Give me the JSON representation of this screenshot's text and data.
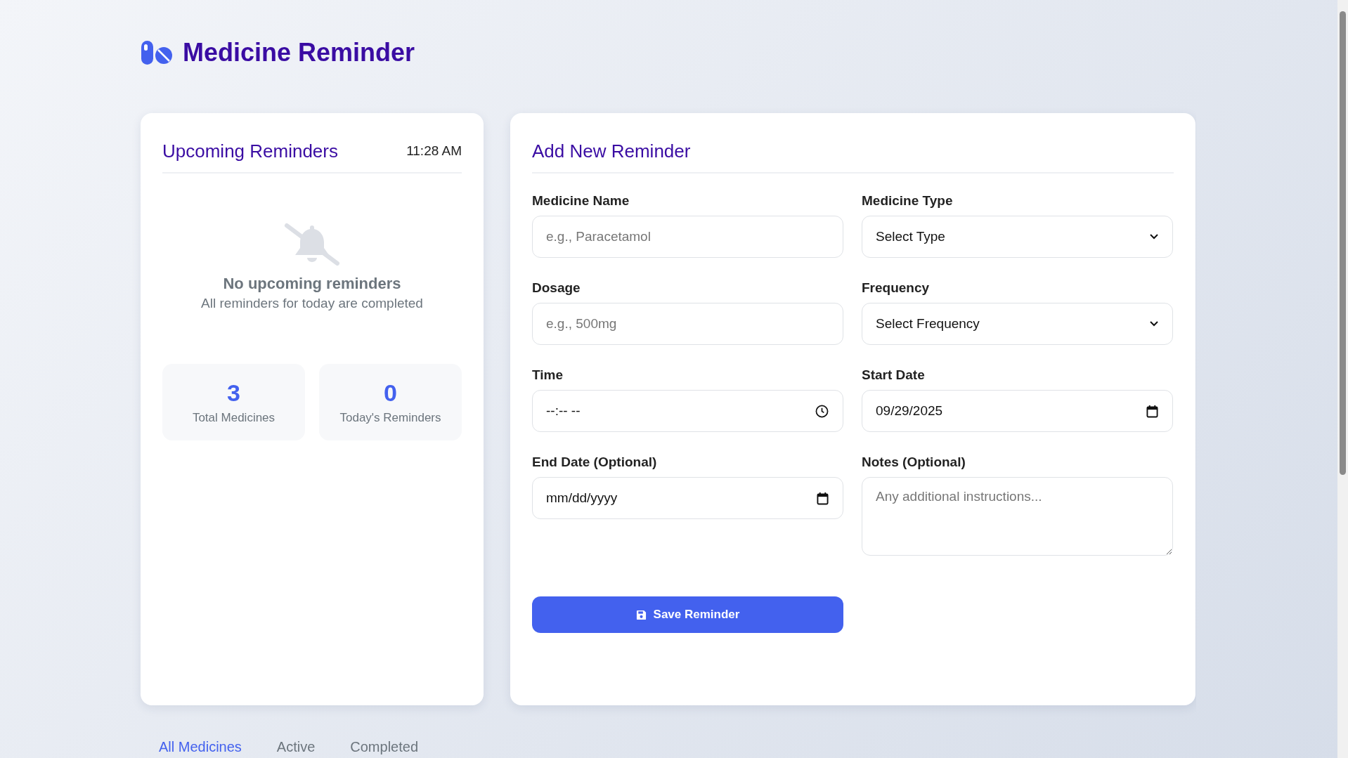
{
  "app": {
    "title": "Medicine Reminder"
  },
  "upcoming": {
    "title": "Upcoming Reminders",
    "time": "11:28 AM",
    "empty_title": "No upcoming reminders",
    "empty_text": "All reminders for today are completed",
    "stats": [
      {
        "value": "3",
        "label": "Total Medicines"
      },
      {
        "value": "0",
        "label": "Today's Reminders"
      }
    ]
  },
  "form": {
    "title": "Add New Reminder",
    "fields": [
      {
        "kind": "text",
        "label": "Medicine Name",
        "placeholder": "e.g., Paracetamol"
      },
      {
        "kind": "select",
        "label": "Medicine Type",
        "value": "Select Type"
      },
      {
        "kind": "text",
        "label": "Dosage",
        "placeholder": "e.g., 500mg"
      },
      {
        "kind": "select",
        "label": "Frequency",
        "value": "Select Frequency"
      },
      {
        "kind": "time",
        "label": "Time",
        "value": "--:-- --"
      },
      {
        "kind": "date",
        "label": "Start Date",
        "value": "09/29/2025"
      },
      {
        "kind": "date",
        "label": "End Date (Optional)",
        "value": "mm/dd/yyyy"
      },
      {
        "kind": "textarea",
        "label": "Notes (Optional)",
        "placeholder": "Any additional instructions..."
      }
    ],
    "submit": "Save Reminder"
  },
  "tabs": [
    {
      "label": "All Medicines",
      "selected": true
    },
    {
      "label": "Active",
      "selected": false
    },
    {
      "label": "Completed",
      "selected": false
    }
  ]
}
